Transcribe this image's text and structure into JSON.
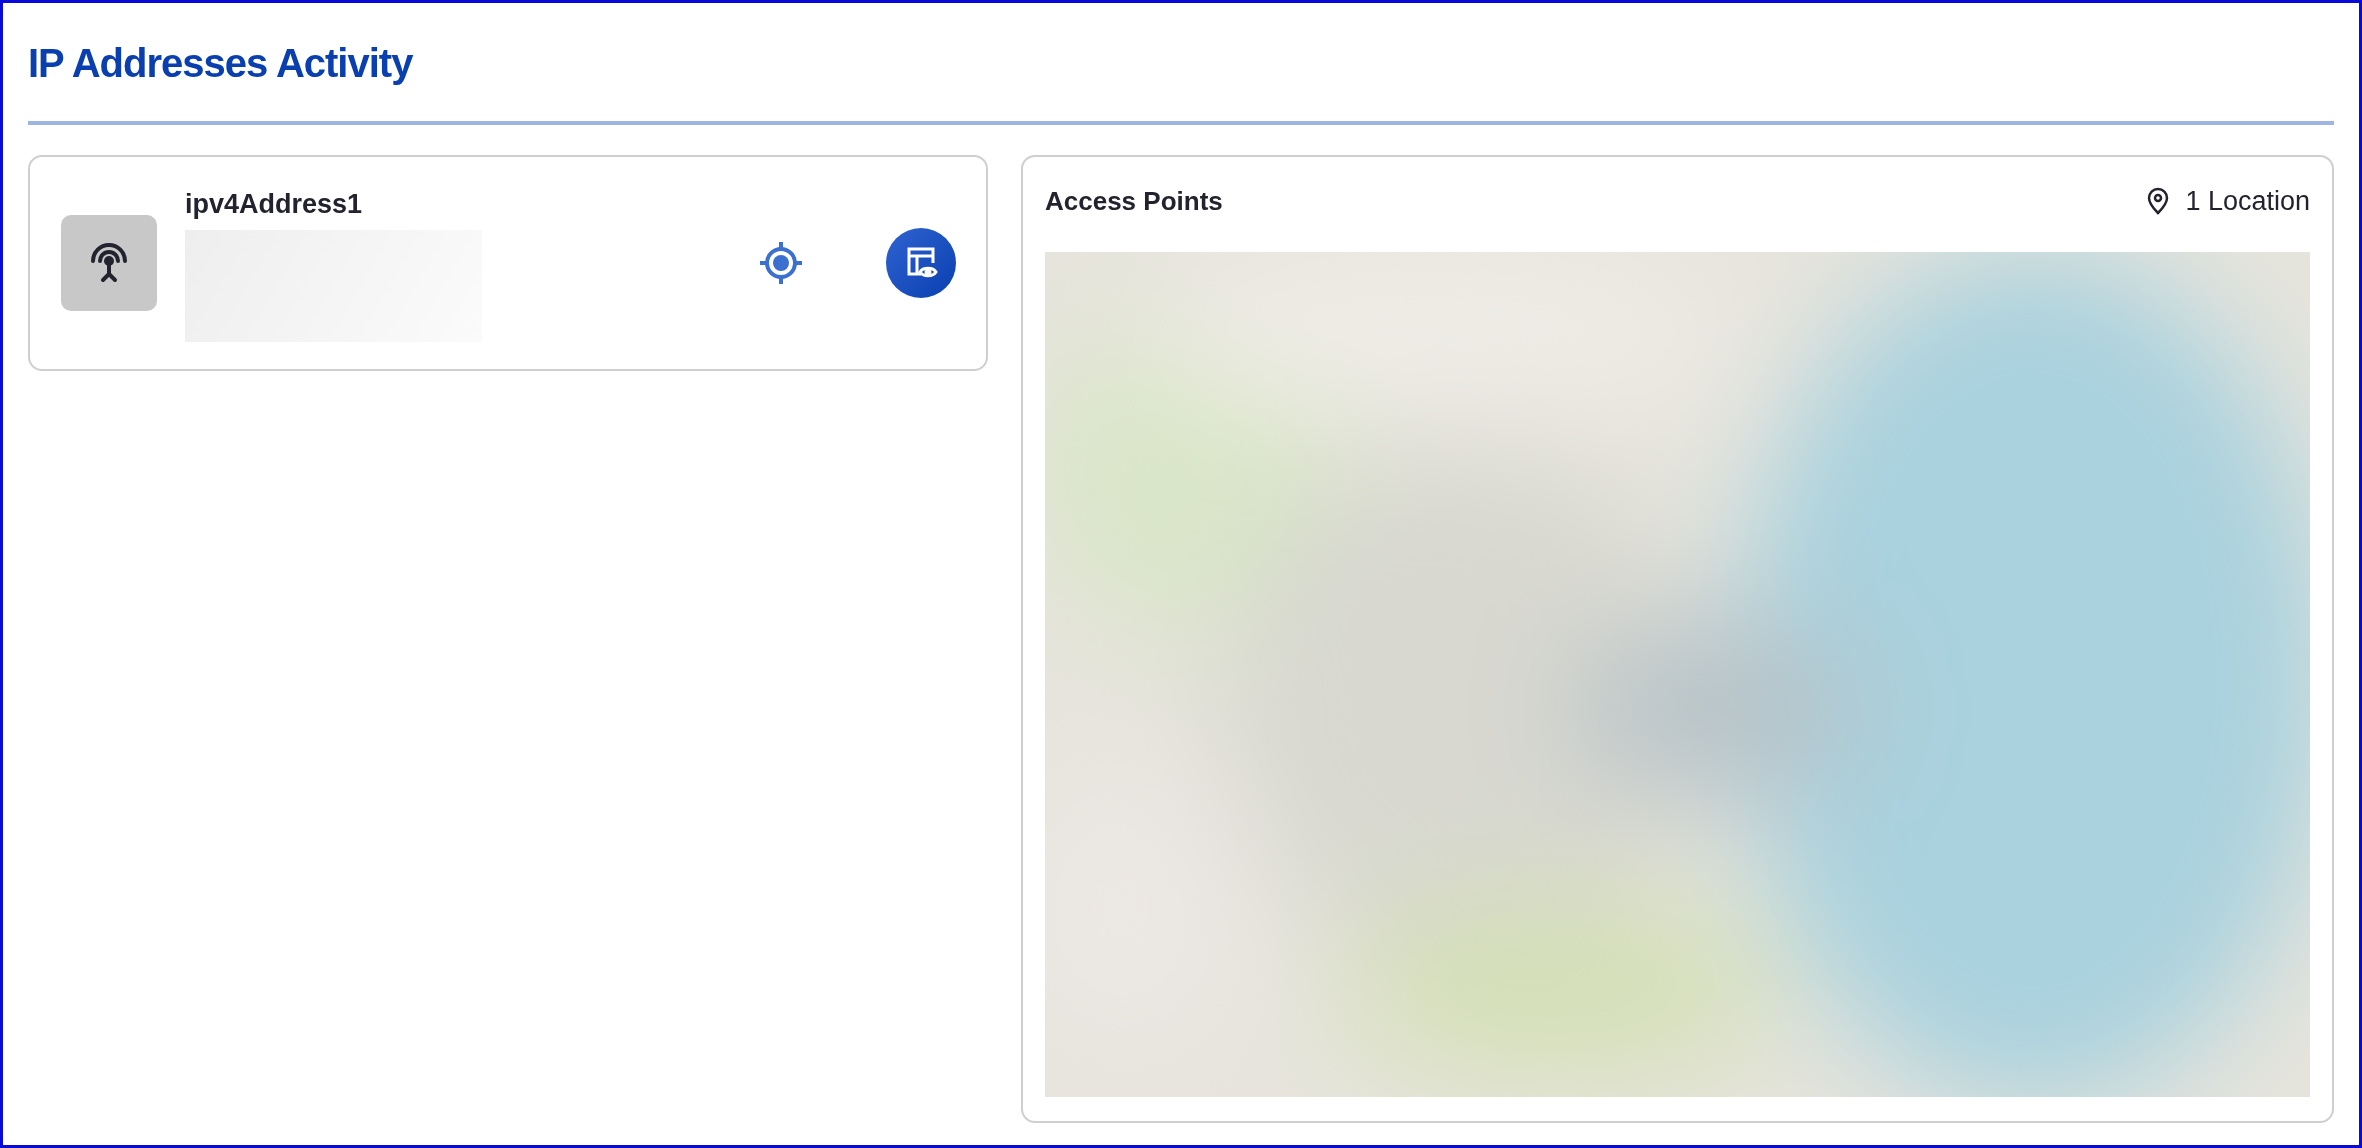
{
  "page": {
    "title": "IP Addresses Activity"
  },
  "ip_card": {
    "name": "ipv4Address1"
  },
  "access_points": {
    "title": "Access Points",
    "location_count": "1 Location"
  }
}
